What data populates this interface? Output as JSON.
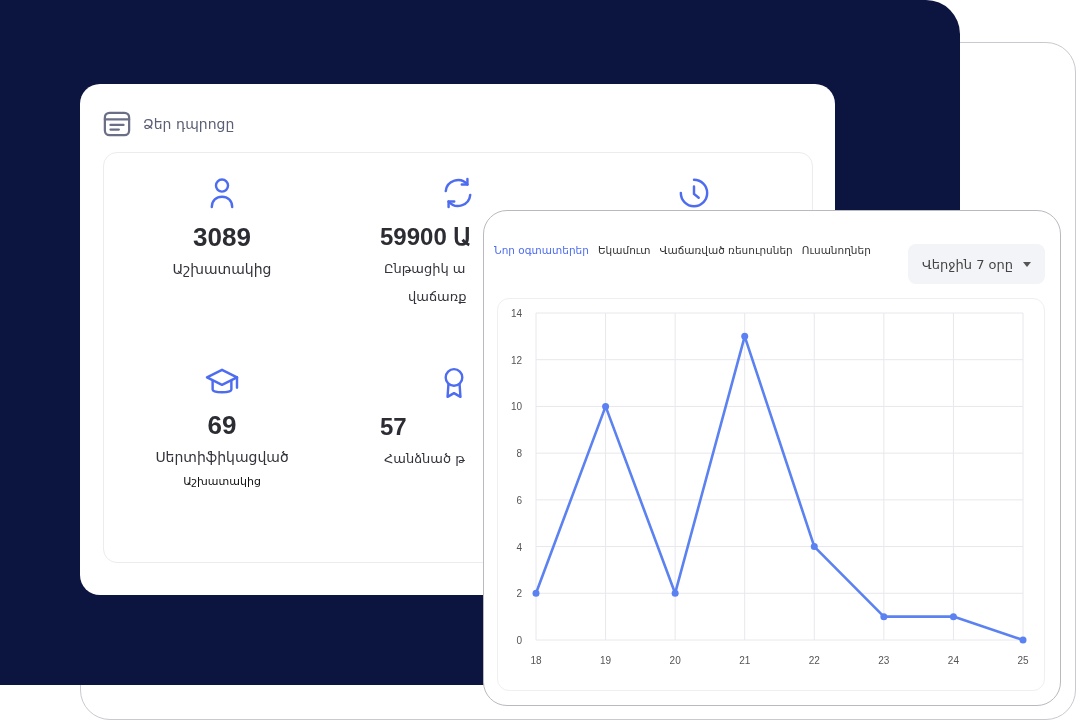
{
  "summary_card": {
    "title": "Ձեր դպրոցը",
    "stats": [
      {
        "value": "3089",
        "label": "Աշխատակից"
      },
      {
        "value": "59900 Ա",
        "label": "Ընթացիկ ա",
        "label_2": "վաճառք"
      },
      {
        "value": "69",
        "label": "Սերտիֆիկացված",
        "sublabel": "Աշխատակից"
      },
      {
        "value": "57",
        "label": "Հանձնած թ"
      }
    ]
  },
  "chart_card": {
    "tabs": [
      {
        "label": "Նոր օգտատերեր",
        "selected": true
      },
      {
        "label": "Եկամուտ",
        "selected": false
      },
      {
        "label": "Վաճառված ռեսուրսներ",
        "selected": false
      },
      {
        "label": "Ուսանողներ",
        "selected": false
      }
    ],
    "period": {
      "value": "Վերջին 7 օրը"
    },
    "chart_data": {
      "type": "line",
      "grid": true,
      "x": [
        "18",
        "19",
        "20",
        "21",
        "22",
        "23",
        "24",
        "25"
      ],
      "series": [
        {
          "color": "#5b82f0",
          "marker": true,
          "values": [
            2,
            10,
            2,
            13,
            4,
            1,
            1,
            0
          ]
        }
      ],
      "ylim": [
        0,
        14
      ],
      "yticks": [
        0,
        2,
        4,
        6,
        8,
        10,
        12,
        14
      ]
    }
  }
}
